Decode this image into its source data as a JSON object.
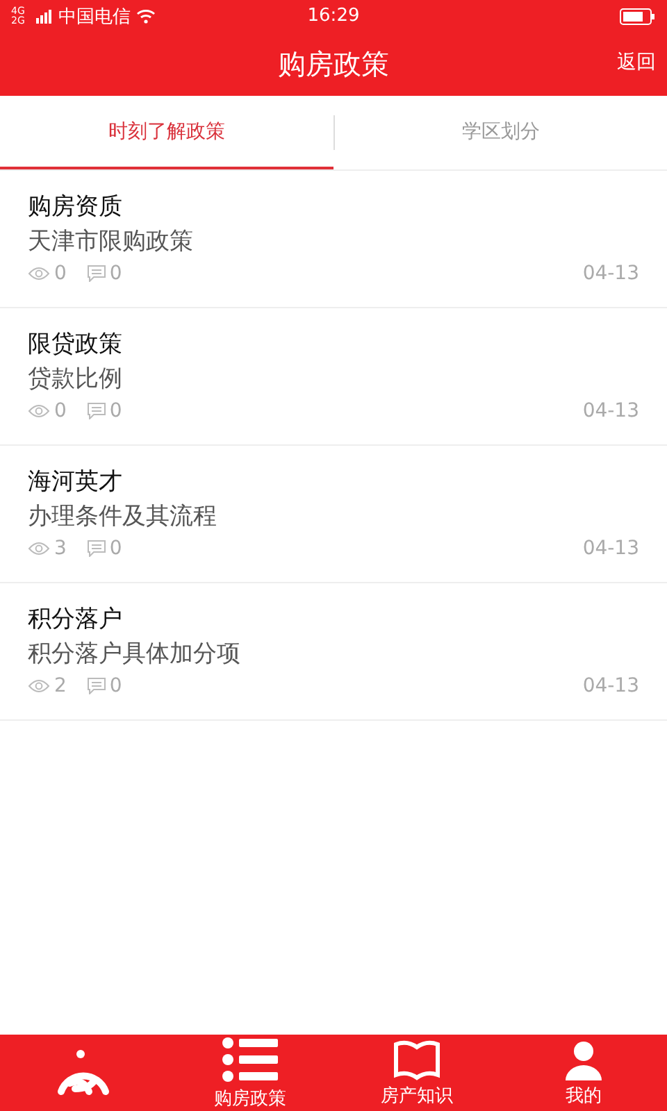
{
  "status_bar": {
    "network": "4G 2G",
    "carrier": "中国电信",
    "time": "16:29"
  },
  "header": {
    "title": "购房政策",
    "back": "返回"
  },
  "tabs": [
    {
      "label": "时刻了解政策",
      "selected": true
    },
    {
      "label": "学区划分",
      "selected": false
    }
  ],
  "articles": [
    {
      "title": "购房资质",
      "subtitle": "天津市限购政策",
      "views": "0",
      "comments": "0",
      "date": "04-13"
    },
    {
      "title": "限贷政策",
      "subtitle": "贷款比例",
      "views": "0",
      "comments": "0",
      "date": "04-13"
    },
    {
      "title": "海河英才",
      "subtitle": "办理条件及其流程",
      "views": "3",
      "comments": "0",
      "date": "04-13"
    },
    {
      "title": "积分落户",
      "subtitle": "积分落户具体加分项",
      "views": "2",
      "comments": "0",
      "date": "04-13"
    }
  ],
  "bottom_nav": [
    {
      "kind": "logo"
    },
    {
      "kind": "list",
      "label": "购房政策"
    },
    {
      "kind": "book",
      "label": "房产知识"
    },
    {
      "kind": "person",
      "label": "我的"
    }
  ]
}
